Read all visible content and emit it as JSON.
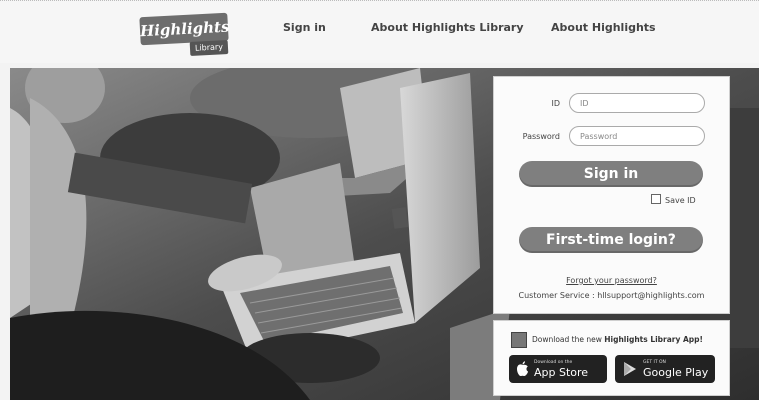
{
  "header": {
    "logo_main": "Highlights",
    "logo_sub": "Library",
    "nav": [
      "Sign in",
      "About Highlights Library",
      "About Highlights"
    ]
  },
  "login": {
    "id_label": "ID",
    "id_placeholder": "ID",
    "password_label": "Password",
    "password_placeholder": "Password",
    "sign_in": "Sign in",
    "save_id": "Save ID",
    "first_time": "First-time login?",
    "forgot": "Forgot your password?",
    "customer_service": "Customer Service : hllsupport@highlights.com"
  },
  "app_promo": {
    "text_prefix": "Download the new ",
    "text_bold": "Highlights Library App!",
    "app_store_small": "Download on the",
    "app_store_big": "App Store",
    "google_small": "GET IT ON",
    "google_big": "Google Play"
  },
  "colors": {
    "button": "#7f7f7f",
    "header_bg": "#f6f6f6",
    "card_bg": "#fbfbfb"
  }
}
